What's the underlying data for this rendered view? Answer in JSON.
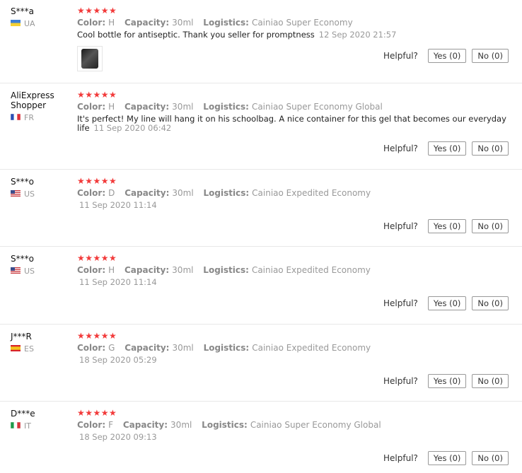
{
  "ui": {
    "helpful_label": "Helpful?",
    "color_key": "Color:",
    "capacity_key": "Capacity:",
    "logistics_key": "Logistics:",
    "star_glyph": "★★★★★",
    "star_color": "#f23a3a"
  },
  "reviews": [
    {
      "user": "S***a",
      "country": "UA",
      "rating": 5,
      "color": "H",
      "capacity": "30ml",
      "logistics": "Cainiao Super Economy",
      "text": "Cool bottle for antiseptic. Thank you seller for promptness",
      "date": "12 Sep 2020 21:57",
      "has_photo": true,
      "yes": "Yes (0)",
      "no": "No (0)"
    },
    {
      "user": "AliExpress Shopper",
      "country": "FR",
      "rating": 5,
      "color": "H",
      "capacity": "30ml",
      "logistics": "Cainiao Super Economy Global",
      "text": "It's perfect! My line will hang it on his schoolbag. A nice container for this gel that becomes our everyday life",
      "date": "11 Sep 2020 06:42",
      "has_photo": false,
      "yes": "Yes (0)",
      "no": "No (0)"
    },
    {
      "user": "S***o",
      "country": "US",
      "rating": 5,
      "color": "D",
      "capacity": "30ml",
      "logistics": "Cainiao Expedited Economy",
      "text": "",
      "date": "11 Sep 2020 11:14",
      "has_photo": false,
      "yes": "Yes (0)",
      "no": "No (0)"
    },
    {
      "user": "S***o",
      "country": "US",
      "rating": 5,
      "color": "H",
      "capacity": "30ml",
      "logistics": "Cainiao Expedited Economy",
      "text": "",
      "date": "11 Sep 2020 11:14",
      "has_photo": false,
      "yes": "Yes (0)",
      "no": "No (0)"
    },
    {
      "user": "J***R",
      "country": "ES",
      "rating": 5,
      "color": "G",
      "capacity": "30ml",
      "logistics": "Cainiao Expedited Economy",
      "text": "",
      "date": "18 Sep 2020 05:29",
      "has_photo": false,
      "yes": "Yes (0)",
      "no": "No (0)"
    },
    {
      "user": "D***e",
      "country": "IT",
      "rating": 5,
      "color": "F",
      "capacity": "30ml",
      "logistics": "Cainiao Super Economy Global",
      "text": "",
      "date": "18 Sep 2020 09:13",
      "has_photo": false,
      "yes": "Yes (0)",
      "no": "No (0)"
    }
  ]
}
